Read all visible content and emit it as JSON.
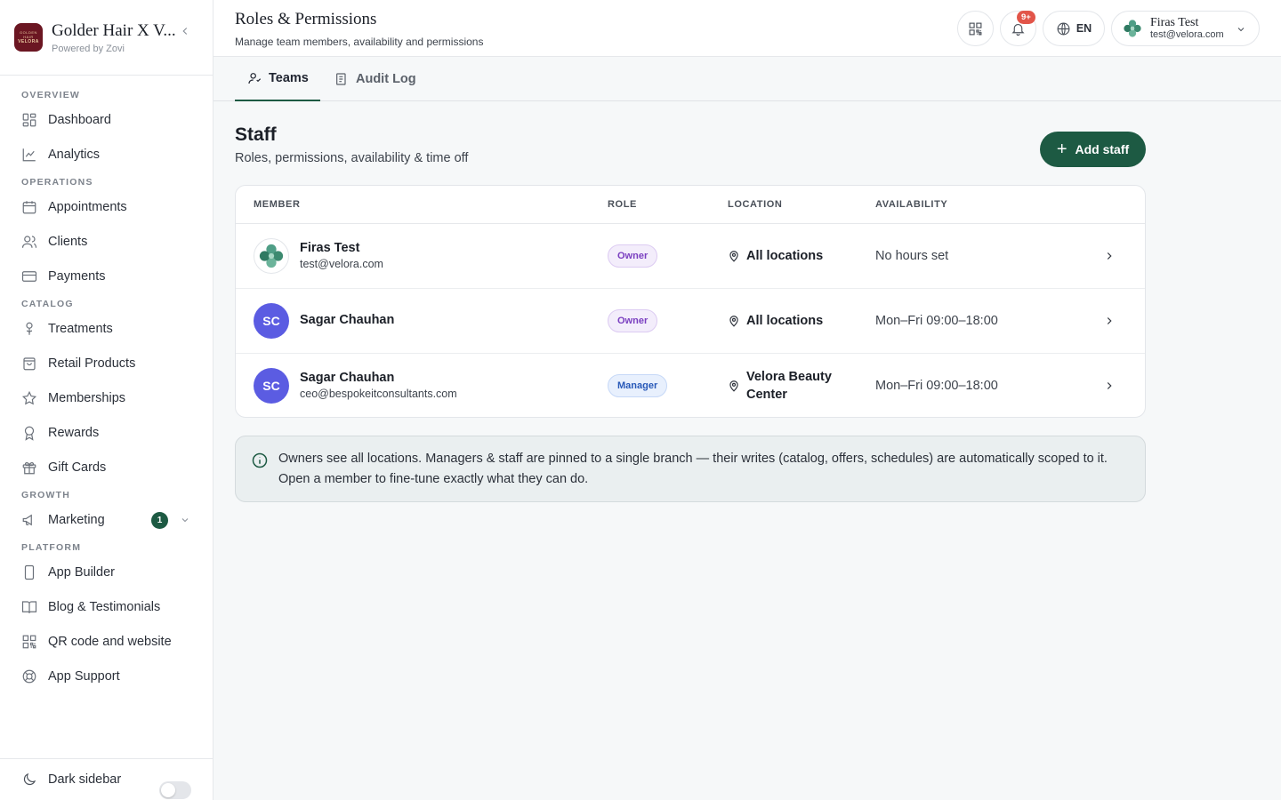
{
  "brand": {
    "logo_line1": "GOLDEN HAIR",
    "logo_line2": "VELORA",
    "title": "Golder Hair X V...",
    "subtitle": "Powered by Zovi"
  },
  "sidebar": {
    "sections": [
      {
        "label": "OVERVIEW",
        "items": [
          {
            "label": "Dashboard",
            "icon": "dashboard-icon"
          },
          {
            "label": "Analytics",
            "icon": "analytics-icon"
          }
        ]
      },
      {
        "label": "OPERATIONS",
        "items": [
          {
            "label": "Appointments",
            "icon": "calendar-icon"
          },
          {
            "label": "Clients",
            "icon": "users-icon"
          },
          {
            "label": "Payments",
            "icon": "credit-card-icon"
          }
        ]
      },
      {
        "label": "CATALOG",
        "items": [
          {
            "label": "Treatments",
            "icon": "flower-icon"
          },
          {
            "label": "Retail Products",
            "icon": "shopping-bag-icon"
          },
          {
            "label": "Memberships",
            "icon": "star-icon"
          },
          {
            "label": "Rewards",
            "icon": "award-icon"
          },
          {
            "label": "Gift Cards",
            "icon": "gift-icon"
          }
        ]
      },
      {
        "label": "GROWTH",
        "items": [
          {
            "label": "Marketing",
            "icon": "megaphone-icon",
            "badge": "1"
          }
        ]
      },
      {
        "label": "PLATFORM",
        "items": [
          {
            "label": "App Builder",
            "icon": "phone-icon"
          },
          {
            "label": "Blog & Testimonials",
            "icon": "book-icon"
          },
          {
            "label": "QR code and website",
            "icon": "qr-icon"
          },
          {
            "label": "App Support",
            "icon": "lifebuoy-icon"
          }
        ]
      }
    ],
    "footer": {
      "label": "Dark sidebar",
      "toggle_on": false
    }
  },
  "header": {
    "title": "Roles & Permissions",
    "subtitle": "Manage team members, availability and permissions",
    "notifications_badge": "9+",
    "language": "EN",
    "user": {
      "name": "Firas Test",
      "email": "test@velora.com"
    }
  },
  "tabs": [
    {
      "label": "Teams",
      "active": true
    },
    {
      "label": "Audit Log",
      "active": false
    }
  ],
  "staff": {
    "title": "Staff",
    "subtitle": "Roles, permissions, availability & time off",
    "add_button": "Add staff",
    "columns": [
      "MEMBER",
      "ROLE",
      "LOCATION",
      "AVAILABILITY"
    ],
    "rows": [
      {
        "name": "Firas Test",
        "email": "test@velora.com",
        "initials": "",
        "role": "Owner",
        "location": "All locations",
        "availability": "No hours set"
      },
      {
        "name": "Sagar Chauhan",
        "email": "",
        "initials": "SC",
        "role": "Owner",
        "location": "All locations",
        "availability": "Mon–Fri 09:00–18:00"
      },
      {
        "name": "Sagar Chauhan",
        "email": "ceo@bespokeitconsultants.com",
        "initials": "SC",
        "role": "Manager",
        "location": "Velora Beauty Center",
        "availability": "Mon–Fri 09:00–18:00"
      }
    ],
    "info": "Owners see all locations. Managers & staff are pinned to a single branch — their writes (catalog, offers, schedules) are automatically scoped to it. Open a member to fine-tune exactly what they can do."
  },
  "colors": {
    "accent": "#1d5a43",
    "owner_badge": "#7a3fc0",
    "manager_badge": "#2859b8",
    "avatar": "#5b5ce2",
    "notification": "#e25549"
  }
}
